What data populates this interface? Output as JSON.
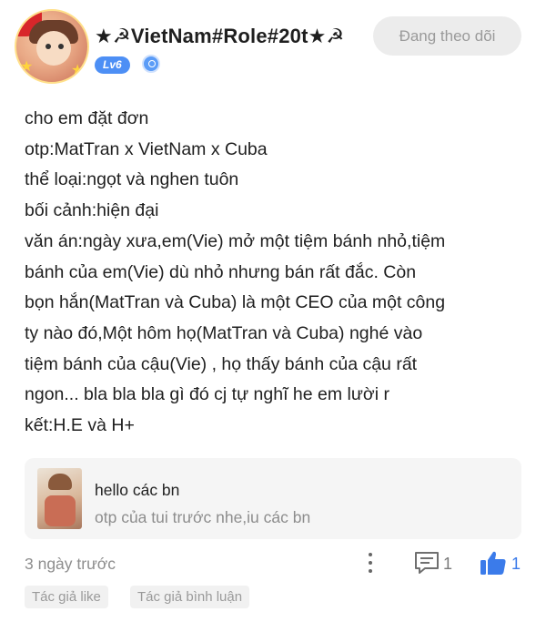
{
  "header": {
    "username": "★☭VietNam#Role#20t★☭",
    "level_badge": "Lv6",
    "follow_label": "Đang theo dõi"
  },
  "post": {
    "lines": [
      "cho em đặt đơn",
      "otp:MatTran x VietNam x Cuba",
      "thể loại:ngọt và nghen tuôn",
      "bối cảnh:hiện đại",
      "văn án:ngày xưa,em(Vie) mở một tiệm bánh nhỏ,tiệm",
      "bánh của em(Vie) dù nhỏ nhưng bán rất đắc. Còn",
      "bọn hắn(MatTran và Cuba) là một CEO của một công",
      "ty nào đó,Một hôm họ(MatTran và Cuba) nghé vào",
      "tiệm bánh của cậu(Vie) , họ thấy bánh của cậu rất",
      "ngon... bla bla bla gì đó cj tự nghĩ he em lười r",
      "kết:H.E và H+"
    ]
  },
  "quote": {
    "title": "hello các bn",
    "subtitle": "otp của tui trước nhe,iu các bn"
  },
  "footer": {
    "timestamp": "3 ngày trước",
    "comment_count": "1",
    "like_count": "1",
    "tags": [
      "Tác giả like",
      "Tác giả bình luận"
    ]
  },
  "colors": {
    "accent": "#3b7bea",
    "badge": "#4d8ff5",
    "muted_text": "#8d8d8d"
  },
  "icons": [
    "avatar-image",
    "verified-icon",
    "more-vertical-icon",
    "comment-icon",
    "thumbs-up-icon"
  ]
}
